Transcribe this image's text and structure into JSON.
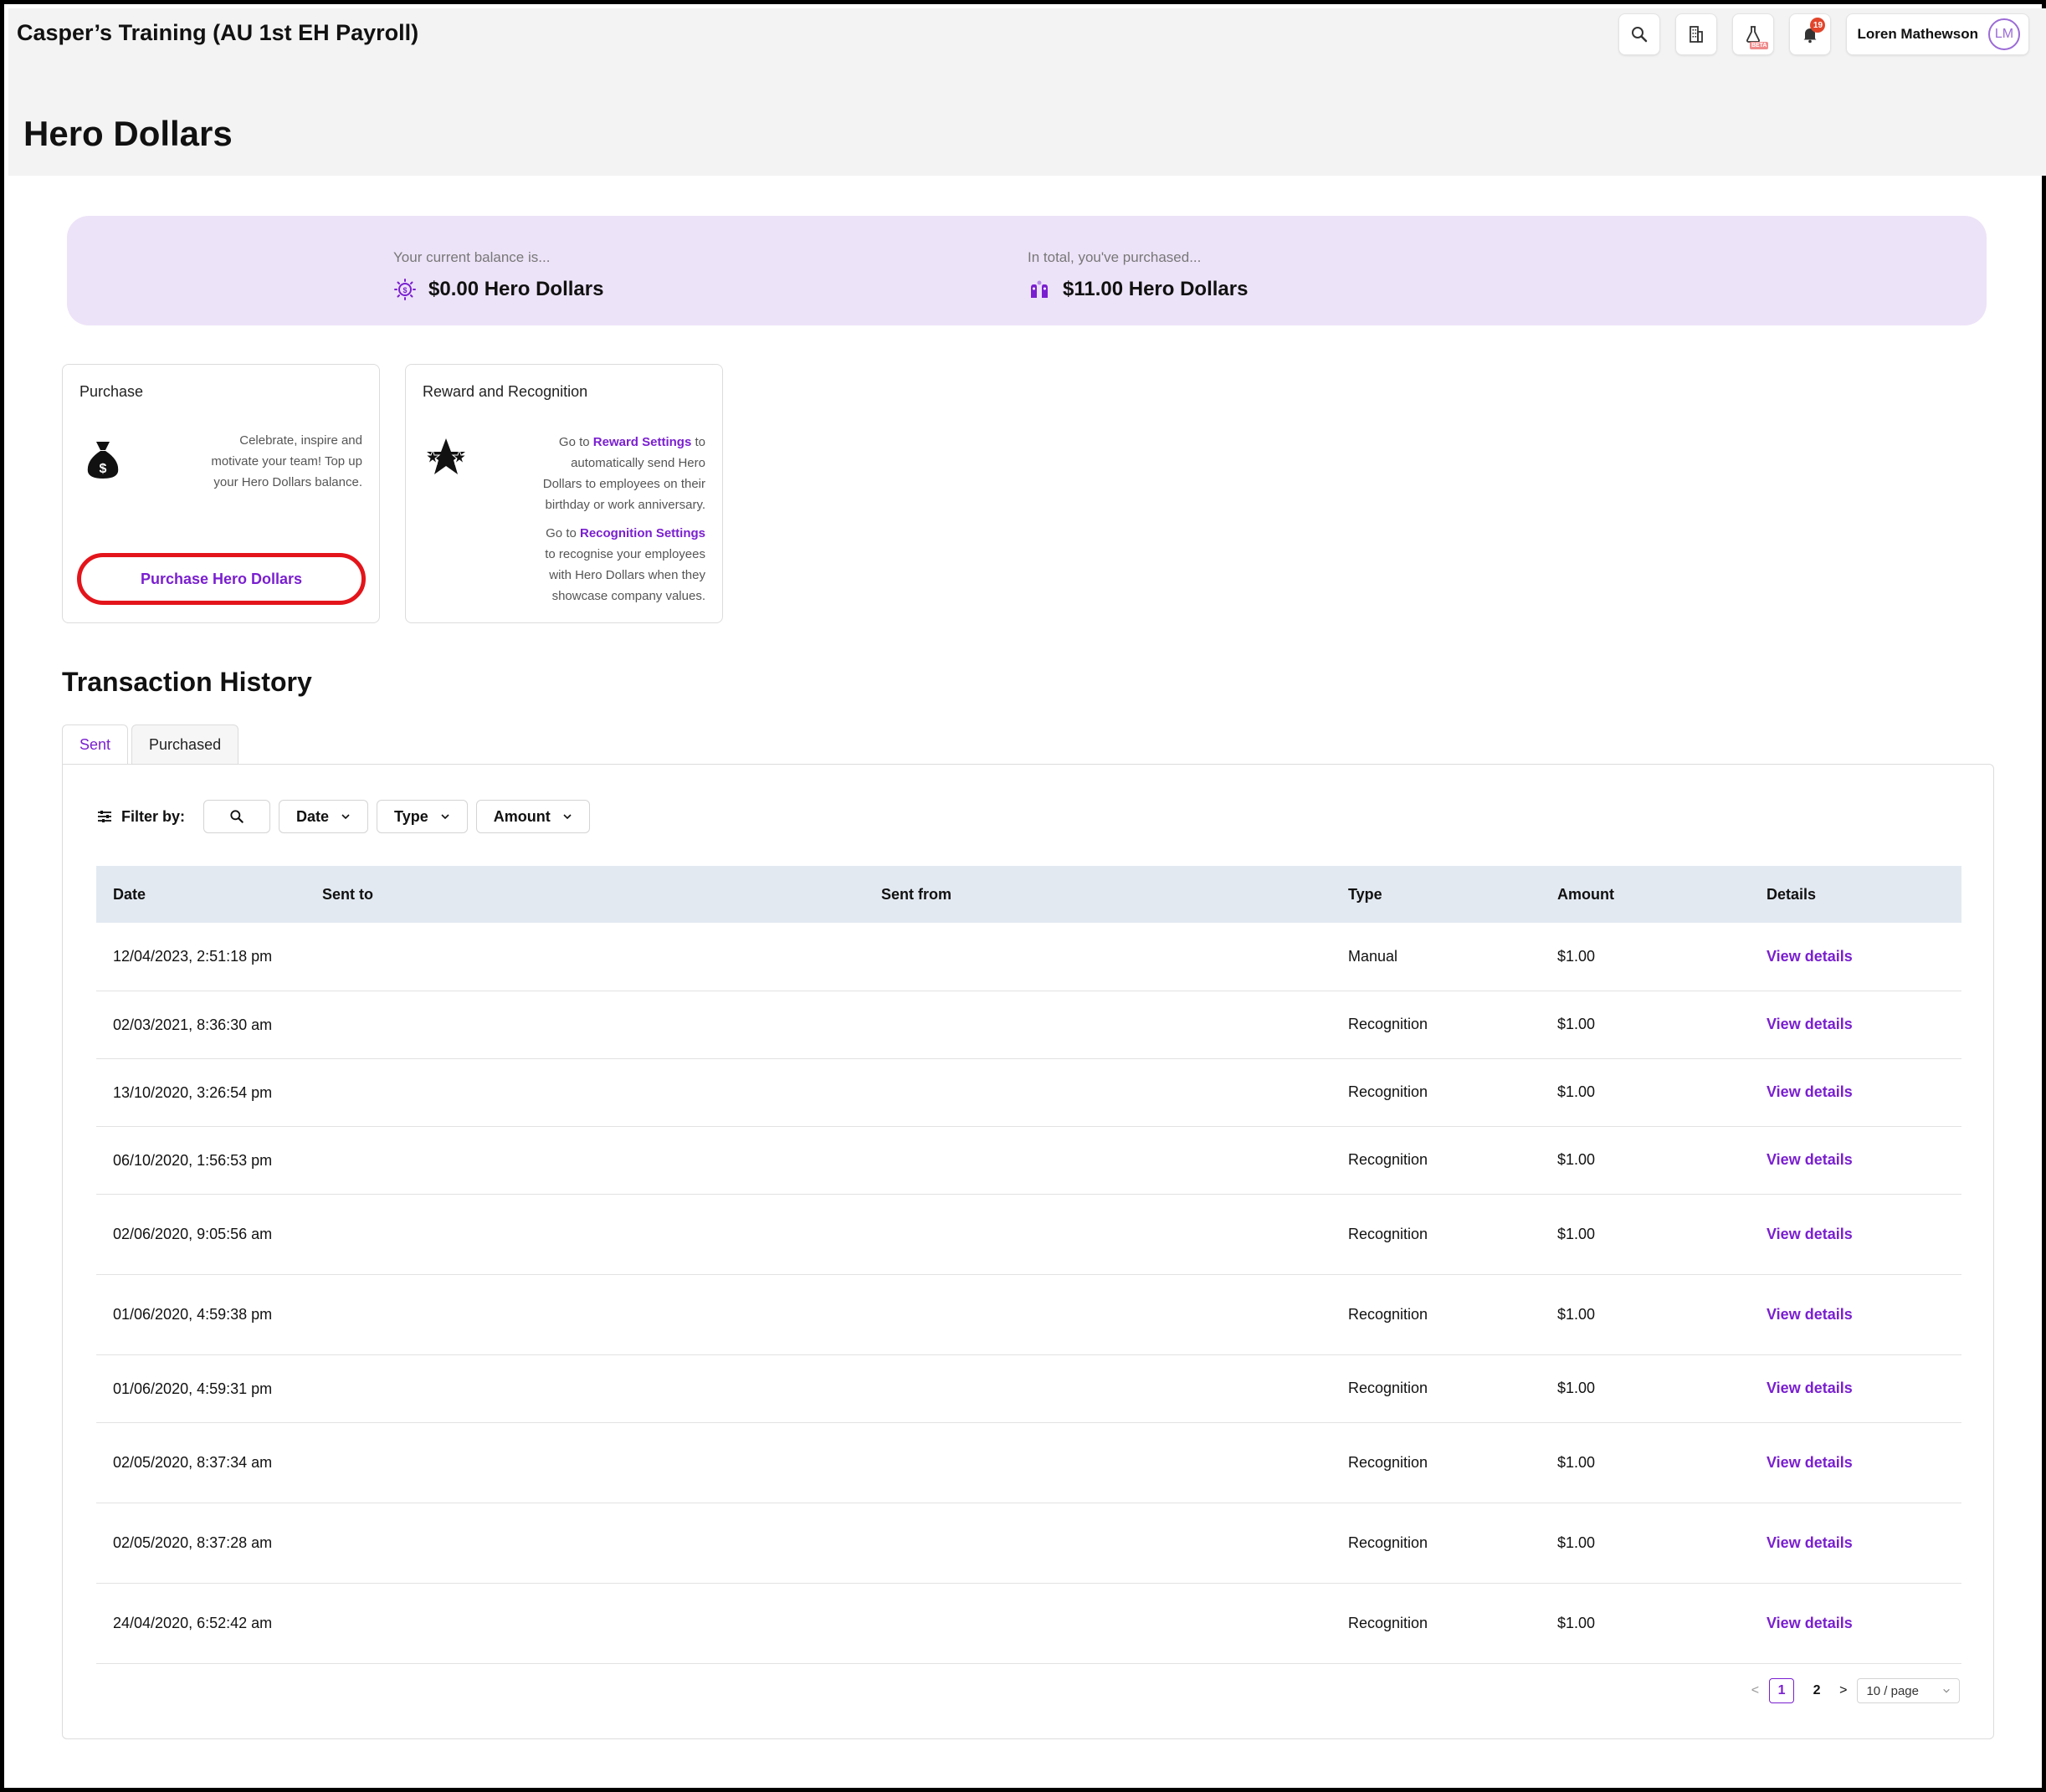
{
  "header": {
    "app_title": "Casper’s Training (AU 1st EH Payroll)",
    "beta_label": "BETA",
    "notification_count": "19",
    "user_name": "Loren Mathewson",
    "user_initials": "LM"
  },
  "page": {
    "title": "Hero Dollars"
  },
  "balance": {
    "current_label": "Your current balance is...",
    "current_value": "$0.00 Hero Dollars",
    "total_label": "In total, you've purchased...",
    "total_value": "$11.00 Hero Dollars"
  },
  "purchase_card": {
    "title": "Purchase",
    "line1": "Celebrate, inspire and",
    "line2": "motivate your team! Top up",
    "line3": "your Hero Dollars balance.",
    "button_label": "Purchase Hero Dollars"
  },
  "reward_card": {
    "title": "Reward and Recognition",
    "p1_prefix": "Go to ",
    "p1_link": "Reward Settings",
    "p1_suffix": " to",
    "p1_line2": "automatically send Hero",
    "p1_line3": "Dollars to employees on their",
    "p1_line4": "birthday or work anniversary.",
    "p2_prefix": "Go to ",
    "p2_link": "Recognition Settings",
    "p2_line2": "to recognise your employees",
    "p2_line3": "with Hero Dollars when they",
    "p2_line4": "showcase company values."
  },
  "history": {
    "title": "Transaction History",
    "tabs": [
      {
        "label": "Sent"
      },
      {
        "label": "Purchased"
      }
    ],
    "filter_label": "Filter by:",
    "filters": {
      "date": "Date",
      "type": "Type",
      "amount": "Amount"
    },
    "columns": {
      "date": "Date",
      "sent_to": "Sent to",
      "sent_from": "Sent from",
      "type": "Type",
      "amount": "Amount",
      "details": "Details"
    },
    "rows": [
      {
        "date": "12/04/2023, 2:51:18 pm",
        "sent_to": "",
        "sent_from": "",
        "type": "Manual",
        "amount": "$1.00",
        "details": "View details"
      },
      {
        "date": "02/03/2021, 8:36:30 am",
        "sent_to": "",
        "sent_from": "",
        "type": "Recognition",
        "amount": "$1.00",
        "details": "View details"
      },
      {
        "date": "13/10/2020, 3:26:54 pm",
        "sent_to": "",
        "sent_from": "",
        "type": "Recognition",
        "amount": "$1.00",
        "details": "View details"
      },
      {
        "date": "06/10/2020, 1:56:53 pm",
        "sent_to": "",
        "sent_from": "",
        "type": "Recognition",
        "amount": "$1.00",
        "details": "View details"
      },
      {
        "date": "02/06/2020, 9:05:56 am",
        "sent_to": "",
        "sent_from": "",
        "type": "Recognition",
        "amount": "$1.00",
        "details": "View details"
      },
      {
        "date": "01/06/2020, 4:59:38 pm",
        "sent_to": "",
        "sent_from": "",
        "type": "Recognition",
        "amount": "$1.00",
        "details": "View details"
      },
      {
        "date": "01/06/2020, 4:59:31 pm",
        "sent_to": "",
        "sent_from": "",
        "type": "Recognition",
        "amount": "$1.00",
        "details": "View details"
      },
      {
        "date": "02/05/2020, 8:37:34 am",
        "sent_to": "",
        "sent_from": "",
        "type": "Recognition",
        "amount": "$1.00",
        "details": "View details"
      },
      {
        "date": "02/05/2020, 8:37:28 am",
        "sent_to": "",
        "sent_from": "",
        "type": "Recognition",
        "amount": "$1.00",
        "details": "View details"
      },
      {
        "date": "24/04/2020, 6:52:42 am",
        "sent_to": "",
        "sent_from": "",
        "type": "Recognition",
        "amount": "$1.00",
        "details": "View details"
      }
    ],
    "pagination": {
      "prev": "<",
      "next": ">",
      "pages": [
        "1",
        "2"
      ],
      "current": "1",
      "page_size": "10 / page"
    }
  },
  "colors": {
    "accent": "#7a1fd0",
    "banner": "#ede3f8",
    "highlight": "#e3151b",
    "table_header": "#e3e9f1"
  }
}
